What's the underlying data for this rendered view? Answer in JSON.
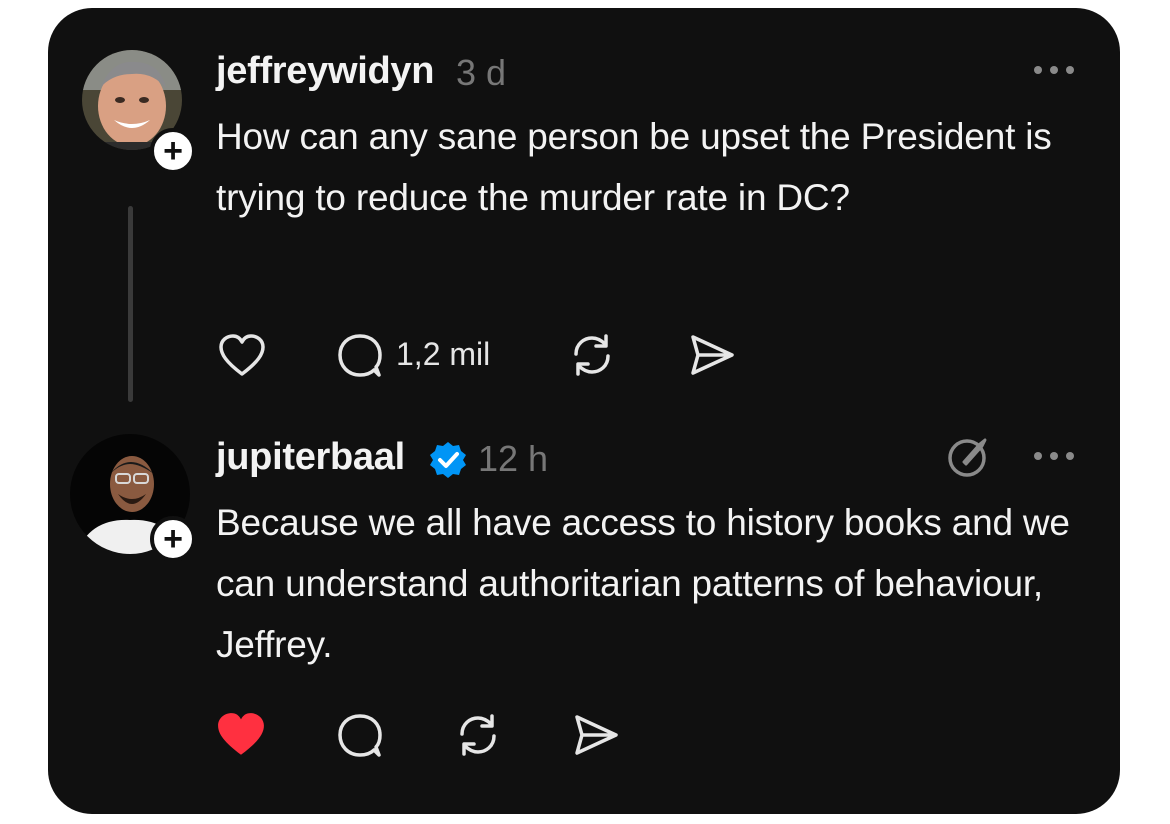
{
  "posts": [
    {
      "username": "jeffreywidyn",
      "time": "3 d",
      "text": "How can any sane person be upset the President is trying to reduce the murder rate in DC?",
      "follow_label": "+",
      "actions": {
        "liked": false,
        "reply_count": "1,2 mil"
      }
    },
    {
      "username": "jupiterbaal",
      "verified": true,
      "time": "12 h",
      "text": "Because we all have access to history books and we can understand authoritarian patterns of behaviour, Jeffrey.",
      "follow_label": "+",
      "actions": {
        "liked": true,
        "reply_count": ""
      }
    }
  ],
  "icons": {
    "like": "heart-icon",
    "reply": "speech-bubble-icon",
    "repost": "repost-arrows-icon",
    "share": "paper-plane-icon",
    "more": "ellipsis-icon",
    "edit": "edit-icon",
    "verified": "verified-badge-icon"
  },
  "colors": {
    "background": "#101010",
    "text": "#f3f3f3",
    "muted": "#777777",
    "like_active": "#ff3040",
    "verified": "#0095f6"
  }
}
